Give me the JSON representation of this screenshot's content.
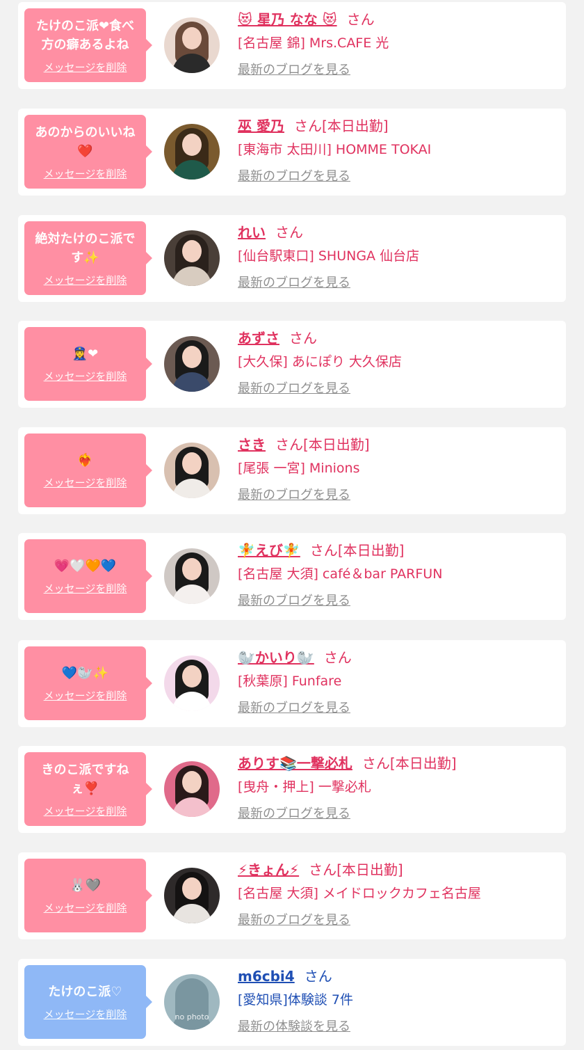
{
  "messages": [
    {
      "bubble": {
        "text": "たけのこ派❤食べ方の癖あるよね",
        "delete": "メッセージを削除",
        "color": "pink"
      },
      "name": "😻 星乃 なな 😻",
      "san": "さん",
      "status": "",
      "shop": "[名古屋 錦] Mrs.CAFE 光",
      "blog": "最新のブログを見る",
      "avatar": {
        "bg": "#e9d8cf",
        "hair": "#6a4a3a",
        "body": "#2a2a2a"
      }
    },
    {
      "bubble": {
        "text": "あのからのいいね❤️",
        "delete": "メッセージを削除",
        "color": "pink"
      },
      "name": "巫 愛乃",
      "san": "さん",
      "status": "[本日出勤]",
      "shop": "[東海市 太田川] HOMME TOKAI",
      "blog": "最新のブログを見る",
      "avatar": {
        "bg": "#7a5a2e",
        "hair": "#3a2a18",
        "body": "#1f5a4a"
      }
    },
    {
      "bubble": {
        "text": "絶対たけのこ派です✨",
        "delete": "メッセージを削除",
        "color": "pink"
      },
      "name": "れい",
      "san": "さん",
      "status": "",
      "shop": "[仙台駅東口] SHUNGA 仙台店",
      "blog": "最新のブログを見る",
      "avatar": {
        "bg": "#4a3f38",
        "hair": "#2a211c",
        "body": "#d8ccc0"
      }
    },
    {
      "bubble": {
        "text": "👮‍♀️❤",
        "delete": "メッセージを削除",
        "color": "pink"
      },
      "name": "あずさ",
      "san": "さん",
      "status": "",
      "shop": "[大久保] あにぽり 大久保店",
      "blog": "最新のブログを見る",
      "avatar": {
        "bg": "#6b5a52",
        "hair": "#1a1a1a",
        "body": "#3a4a6a"
      }
    },
    {
      "bubble": {
        "text": "❤️‍🔥",
        "delete": "メッセージを削除",
        "color": "pink"
      },
      "name": "さき",
      "san": "さん",
      "status": "[本日出勤]",
      "shop": "[尾張 一宮] Minions",
      "blog": "最新のブログを見る",
      "avatar": {
        "bg": "#d8c0b0",
        "hair": "#1a1a1a",
        "body": "#f0ece8"
      }
    },
    {
      "bubble": {
        "text": "💗🤍🧡💙",
        "delete": "メッセージを削除",
        "color": "pink"
      },
      "name": "🧚えび🧚",
      "san": "さん",
      "status": "[本日出勤]",
      "shop": "[名古屋 大須] café＆bar PARFUN",
      "blog": "最新のブログを見る",
      "avatar": {
        "bg": "#cfc8c4",
        "hair": "#1a1a1a",
        "body": "#f4f0ee"
      }
    },
    {
      "bubble": {
        "text": "💙🦭✨",
        "delete": "メッセージを削除",
        "color": "pink"
      },
      "name": "🦭かいり🦭",
      "san": "さん",
      "status": "",
      "shop": "[秋葉原] Funfare",
      "blog": "最新のブログを見る",
      "avatar": {
        "bg": "#f3d9ea",
        "hair": "#1a1a1a",
        "body": "#ffffff"
      }
    },
    {
      "bubble": {
        "text": "きのこ派ですねぇ❣️",
        "delete": "メッセージを削除",
        "color": "pink"
      },
      "name": "ありす📚一撃必札",
      "san": "さん",
      "status": "[本日出勤]",
      "shop": "[曳舟・押上] 一撃必札",
      "blog": "最新のブログを見る",
      "avatar": {
        "bg": "#e06a8a",
        "hair": "#2a1a1a",
        "body": "#f4c0cc"
      }
    },
    {
      "bubble": {
        "text": "🐰🩶",
        "delete": "メッセージを削除",
        "color": "pink"
      },
      "name": "⚡きょん⚡",
      "san": "さん",
      "status": "[本日出勤]",
      "shop": "[名古屋 大須] メイドロックカフェ名古屋",
      "blog": "最新のブログを見る",
      "avatar": {
        "bg": "#2e2a2a",
        "hair": "#141212",
        "body": "#e8e4e0"
      }
    },
    {
      "bubble": {
        "text": "たけのこ派♡",
        "delete": "メッセージを削除",
        "color": "blue"
      },
      "name": "m6cbi4",
      "san": "さん",
      "status": "",
      "shop": "[愛知県]体験談 7件",
      "blog": "最新の体験談を見る",
      "avatar": {
        "bg": "#9fb8c0",
        "hair": "#7a96a0",
        "body": "#7a96a0",
        "nophoto": "no photo"
      }
    }
  ]
}
